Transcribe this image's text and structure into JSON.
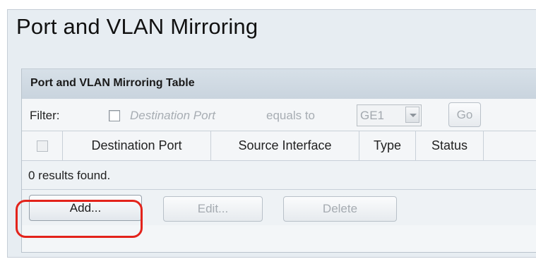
{
  "page": {
    "title": "Port and VLAN Mirroring"
  },
  "table": {
    "title": "Port and VLAN Mirroring Table",
    "filter": {
      "label": "Filter:",
      "field": "Destination Port",
      "operator": "equals to",
      "selected_value": "GE1",
      "go_label": "Go"
    },
    "columns": [
      "Destination Port",
      "Source Interface",
      "Type",
      "Status"
    ],
    "results_text": "0 results found.",
    "actions": {
      "add_label": "Add...",
      "edit_label": "Edit...",
      "delete_label": "Delete"
    }
  },
  "colors": {
    "highlight": "#e3231b",
    "panel_bg": "#e7edf2"
  }
}
